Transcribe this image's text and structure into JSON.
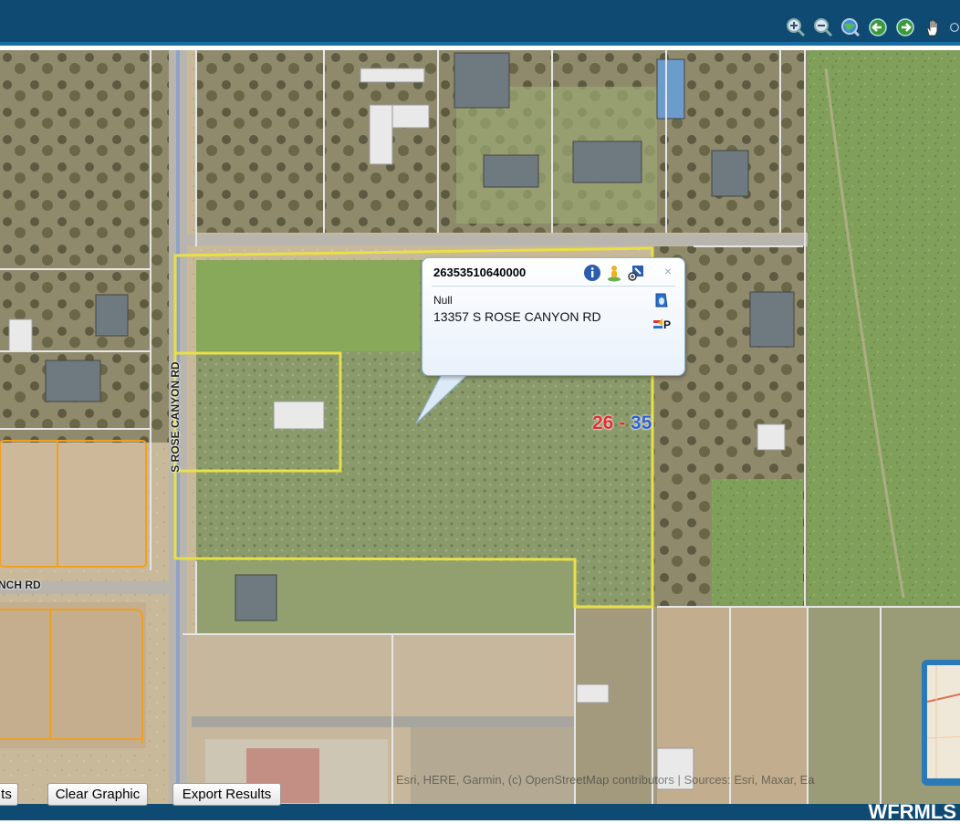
{
  "toolbar": {
    "icons": [
      "zoom-in-icon",
      "zoom-out-icon",
      "globe-icon",
      "back-arrow-icon",
      "forward-arrow-icon",
      "pan-hand-icon",
      "more-icon"
    ]
  },
  "popup": {
    "parcel_id": "26353510640000",
    "owner": "Null",
    "address": "13357 S ROSE CANYON RD",
    "icons": [
      "info-icon",
      "person-icon",
      "zoom-to-icon",
      "close-icon",
      "tag-icon",
      "flag-icon"
    ],
    "close_label": "×"
  },
  "map": {
    "street_labels": {
      "rose_canyon": "S ROSE CANYON RD",
      "ranch": "NCH RD"
    },
    "parcel_label_a": "26",
    "parcel_label_sep": " - ",
    "parcel_label_b": "35",
    "attribution": "Esri, HERE, Garmin, (c) OpenStreetMap contributors | Sources: Esri, Maxar, Ea",
    "colors": {
      "selected_parcel": "#e8e047",
      "parcel_lines": "#dedede",
      "subdivision_lines": "#f0a020",
      "label_red": "#e03030",
      "label_blue": "#3060d0"
    }
  },
  "buttons": {
    "results_partial": "ts",
    "clear_graphic": "Clear Graphic",
    "export_results": "Export Results"
  },
  "watermark": "WFRMLS"
}
